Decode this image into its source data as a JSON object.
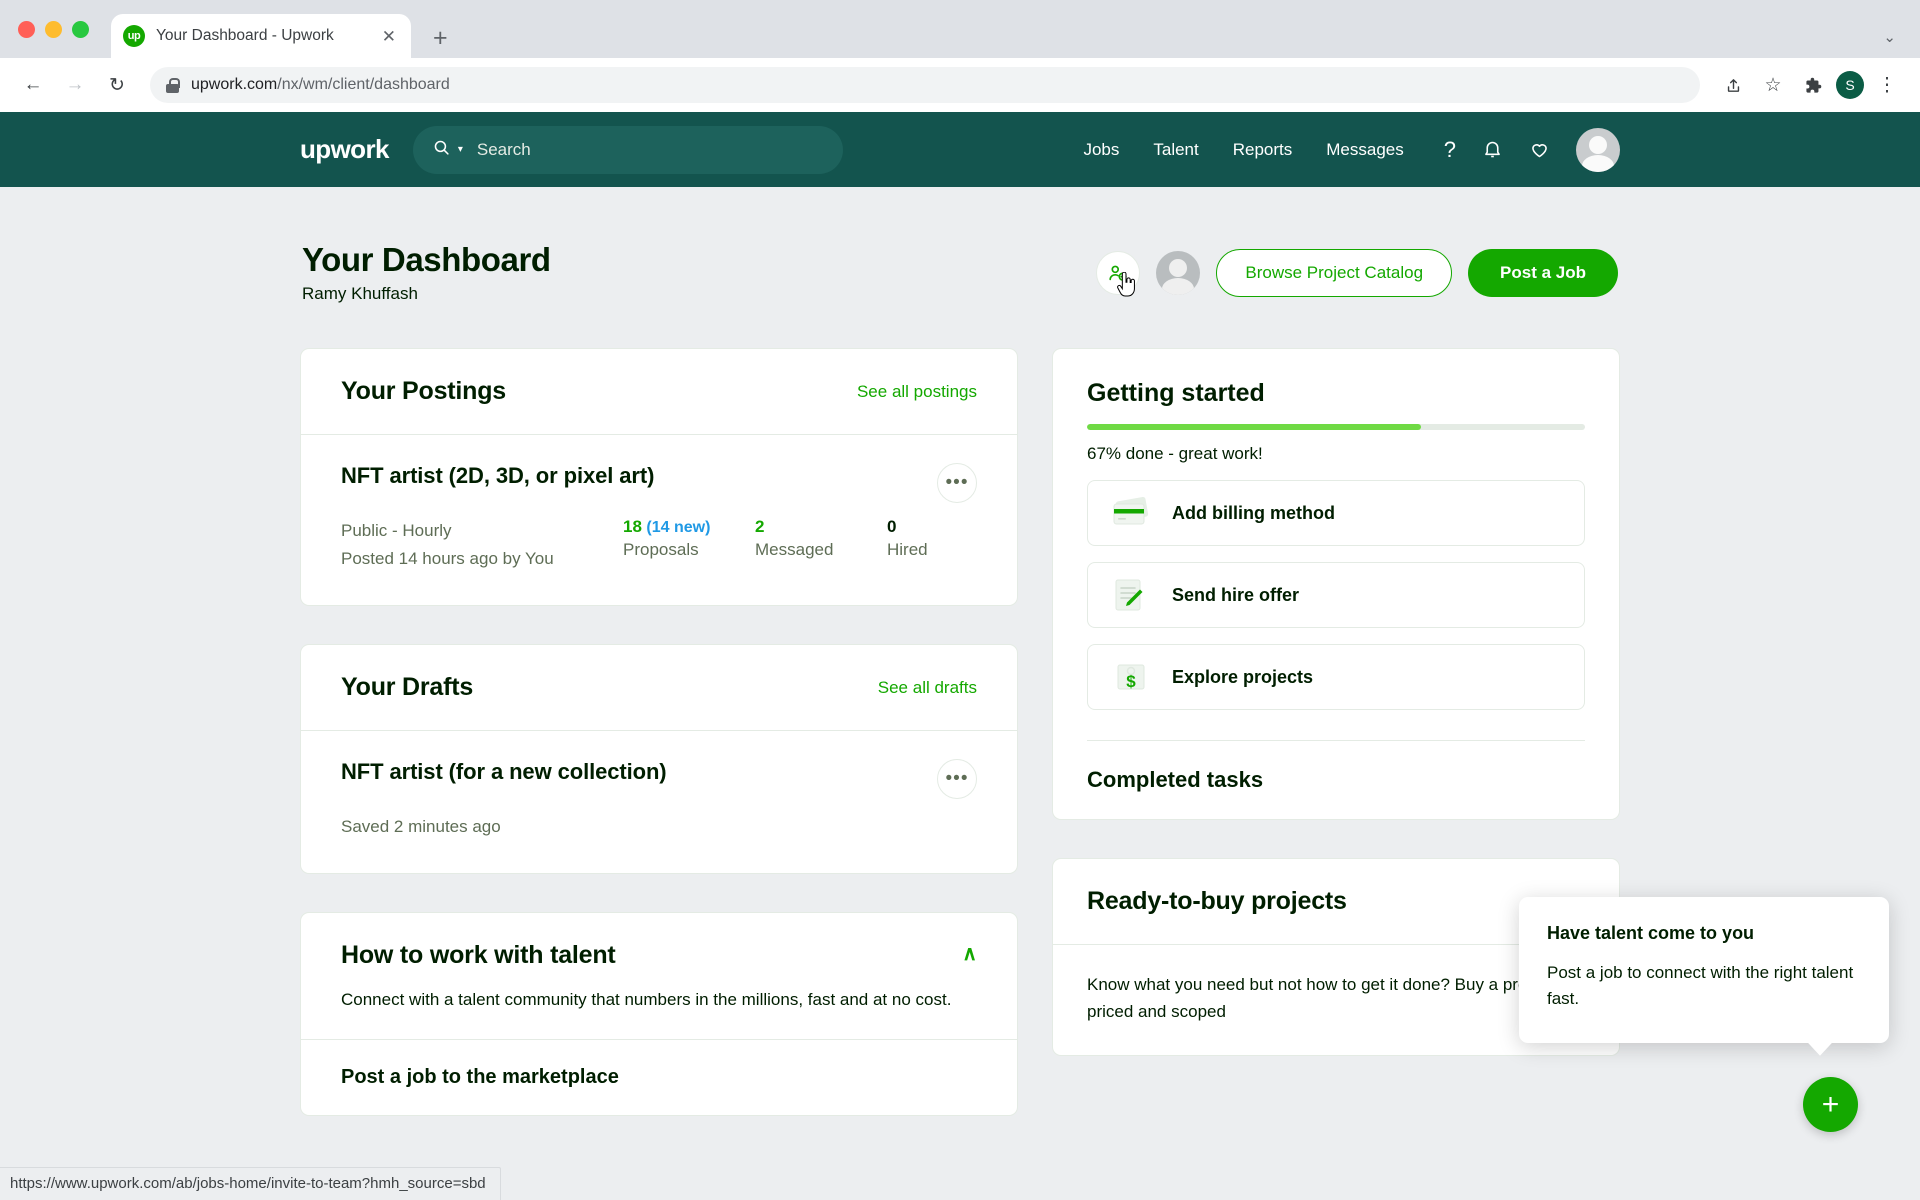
{
  "browser": {
    "tab_title": "Your Dashboard - Upwork",
    "favicon_text": "up",
    "close_label": "✕",
    "newtab_label": "+",
    "tablist_chevron": "⌄",
    "back_icon": "←",
    "forward_icon": "→",
    "reload_icon": "↻",
    "url_domain": "upwork.com",
    "url_path": "/nx/wm/client/dashboard",
    "share_icon": "⇧",
    "bookmark_icon": "☆",
    "extensions_icon": "❖",
    "profile_initial": "S",
    "menu_icon": "⋮",
    "status_url": "https://www.upwork.com/ab/jobs-home/invite-to-team?hmh_source=sbd"
  },
  "nav": {
    "logo": "upwork",
    "search_placeholder": "Search",
    "search_icon": "⌕",
    "caret_icon": "▾",
    "links": [
      "Jobs",
      "Talent",
      "Reports",
      "Messages"
    ],
    "help_icon": "?",
    "notifications_icon": "bell",
    "saved_icon": "heart"
  },
  "header": {
    "title": "Your Dashboard",
    "user": "Ramy Khuffash",
    "invite_team_icon": "add-person-icon",
    "browse_catalog": "Browse Project Catalog",
    "post_job": "Post a Job"
  },
  "postings": {
    "title": "Your Postings",
    "see_all": "See all postings",
    "job_title": "NFT artist (2D, 3D, or pixel art)",
    "type": "Public - Hourly",
    "posted": "Posted 14 hours ago by You",
    "more_icon": "•••",
    "stats": [
      {
        "num": "18",
        "new": "(14 new)",
        "label": "Proposals",
        "dark": false
      },
      {
        "num": "2",
        "new": "",
        "label": "Messaged",
        "dark": false
      },
      {
        "num": "0",
        "new": "",
        "label": "Hired",
        "dark": true
      }
    ]
  },
  "drafts": {
    "title": "Your Drafts",
    "see_all": "See all drafts",
    "draft_title": "NFT artist (for a new collection)",
    "saved": "Saved 2 minutes ago",
    "more_icon": "•••"
  },
  "how_to": {
    "title": "How to work with talent",
    "collapse_icon": "∧",
    "body": "Connect with a talent community that numbers in the millions, fast and at no cost.",
    "sub_item": "Post a job to the marketplace"
  },
  "getting_started": {
    "title": "Getting started",
    "progress_percent": 67,
    "progress_label": "67% done - great work!",
    "tasks": [
      {
        "label": "Add billing method",
        "icon": "credit-card-icon"
      },
      {
        "label": "Send hire offer",
        "icon": "document-pen-icon"
      },
      {
        "label": "Explore projects",
        "icon": "money-icon"
      }
    ],
    "completed_title": "Completed tasks"
  },
  "ready_to_buy": {
    "title": "Ready-to-buy projects",
    "body": "Know what you need but not how to get it done? Buy a project priced and scoped"
  },
  "tooltip": {
    "title": "Have talent come to you",
    "body": "Post a job to connect with the right talent fast."
  },
  "fab": {
    "icon": "+"
  },
  "colors": {
    "brand_green": "#14a800",
    "progress_green": "#6fda44",
    "nav_dark": "#13544e",
    "new_blue": "#1f99e5"
  }
}
